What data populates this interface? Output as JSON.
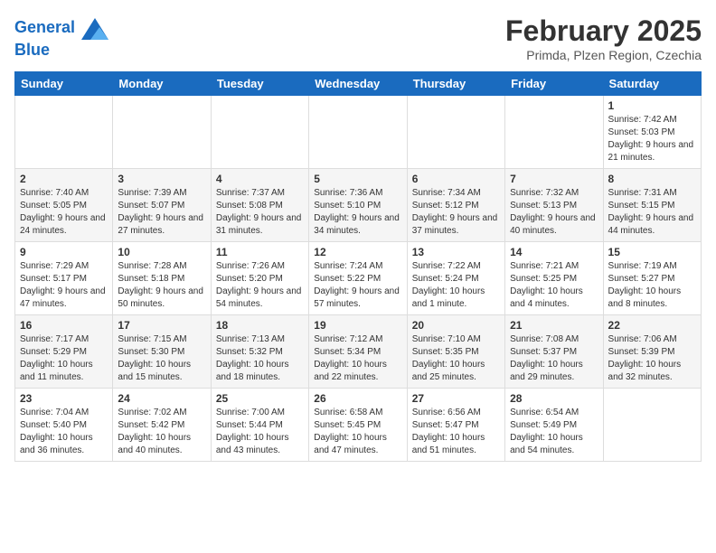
{
  "header": {
    "logo_line1": "General",
    "logo_line2": "Blue",
    "month": "February 2025",
    "location": "Primda, Plzen Region, Czechia"
  },
  "weekdays": [
    "Sunday",
    "Monday",
    "Tuesday",
    "Wednesday",
    "Thursday",
    "Friday",
    "Saturday"
  ],
  "weeks": [
    [
      {
        "day": "",
        "info": ""
      },
      {
        "day": "",
        "info": ""
      },
      {
        "day": "",
        "info": ""
      },
      {
        "day": "",
        "info": ""
      },
      {
        "day": "",
        "info": ""
      },
      {
        "day": "",
        "info": ""
      },
      {
        "day": "1",
        "info": "Sunrise: 7:42 AM\nSunset: 5:03 PM\nDaylight: 9 hours and 21 minutes."
      }
    ],
    [
      {
        "day": "2",
        "info": "Sunrise: 7:40 AM\nSunset: 5:05 PM\nDaylight: 9 hours and 24 minutes."
      },
      {
        "day": "3",
        "info": "Sunrise: 7:39 AM\nSunset: 5:07 PM\nDaylight: 9 hours and 27 minutes."
      },
      {
        "day": "4",
        "info": "Sunrise: 7:37 AM\nSunset: 5:08 PM\nDaylight: 9 hours and 31 minutes."
      },
      {
        "day": "5",
        "info": "Sunrise: 7:36 AM\nSunset: 5:10 PM\nDaylight: 9 hours and 34 minutes."
      },
      {
        "day": "6",
        "info": "Sunrise: 7:34 AM\nSunset: 5:12 PM\nDaylight: 9 hours and 37 minutes."
      },
      {
        "day": "7",
        "info": "Sunrise: 7:32 AM\nSunset: 5:13 PM\nDaylight: 9 hours and 40 minutes."
      },
      {
        "day": "8",
        "info": "Sunrise: 7:31 AM\nSunset: 5:15 PM\nDaylight: 9 hours and 44 minutes."
      }
    ],
    [
      {
        "day": "9",
        "info": "Sunrise: 7:29 AM\nSunset: 5:17 PM\nDaylight: 9 hours and 47 minutes."
      },
      {
        "day": "10",
        "info": "Sunrise: 7:28 AM\nSunset: 5:18 PM\nDaylight: 9 hours and 50 minutes."
      },
      {
        "day": "11",
        "info": "Sunrise: 7:26 AM\nSunset: 5:20 PM\nDaylight: 9 hours and 54 minutes."
      },
      {
        "day": "12",
        "info": "Sunrise: 7:24 AM\nSunset: 5:22 PM\nDaylight: 9 hours and 57 minutes."
      },
      {
        "day": "13",
        "info": "Sunrise: 7:22 AM\nSunset: 5:24 PM\nDaylight: 10 hours and 1 minute."
      },
      {
        "day": "14",
        "info": "Sunrise: 7:21 AM\nSunset: 5:25 PM\nDaylight: 10 hours and 4 minutes."
      },
      {
        "day": "15",
        "info": "Sunrise: 7:19 AM\nSunset: 5:27 PM\nDaylight: 10 hours and 8 minutes."
      }
    ],
    [
      {
        "day": "16",
        "info": "Sunrise: 7:17 AM\nSunset: 5:29 PM\nDaylight: 10 hours and 11 minutes."
      },
      {
        "day": "17",
        "info": "Sunrise: 7:15 AM\nSunset: 5:30 PM\nDaylight: 10 hours and 15 minutes."
      },
      {
        "day": "18",
        "info": "Sunrise: 7:13 AM\nSunset: 5:32 PM\nDaylight: 10 hours and 18 minutes."
      },
      {
        "day": "19",
        "info": "Sunrise: 7:12 AM\nSunset: 5:34 PM\nDaylight: 10 hours and 22 minutes."
      },
      {
        "day": "20",
        "info": "Sunrise: 7:10 AM\nSunset: 5:35 PM\nDaylight: 10 hours and 25 minutes."
      },
      {
        "day": "21",
        "info": "Sunrise: 7:08 AM\nSunset: 5:37 PM\nDaylight: 10 hours and 29 minutes."
      },
      {
        "day": "22",
        "info": "Sunrise: 7:06 AM\nSunset: 5:39 PM\nDaylight: 10 hours and 32 minutes."
      }
    ],
    [
      {
        "day": "23",
        "info": "Sunrise: 7:04 AM\nSunset: 5:40 PM\nDaylight: 10 hours and 36 minutes."
      },
      {
        "day": "24",
        "info": "Sunrise: 7:02 AM\nSunset: 5:42 PM\nDaylight: 10 hours and 40 minutes."
      },
      {
        "day": "25",
        "info": "Sunrise: 7:00 AM\nSunset: 5:44 PM\nDaylight: 10 hours and 43 minutes."
      },
      {
        "day": "26",
        "info": "Sunrise: 6:58 AM\nSunset: 5:45 PM\nDaylight: 10 hours and 47 minutes."
      },
      {
        "day": "27",
        "info": "Sunrise: 6:56 AM\nSunset: 5:47 PM\nDaylight: 10 hours and 51 minutes."
      },
      {
        "day": "28",
        "info": "Sunrise: 6:54 AM\nSunset: 5:49 PM\nDaylight: 10 hours and 54 minutes."
      },
      {
        "day": "",
        "info": ""
      }
    ]
  ]
}
